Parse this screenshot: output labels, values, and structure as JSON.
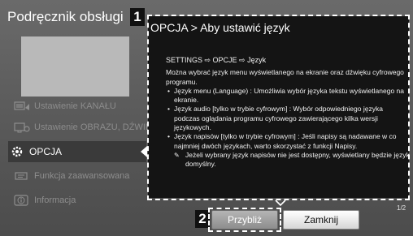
{
  "app_title": "Podręcznik obsługi",
  "callouts": {
    "first": "1",
    "second": "2"
  },
  "sidebar": {
    "items": [
      {
        "label": "Ustawienie KANAŁU",
        "icon": "channel-settings-icon"
      },
      {
        "label": "Ustawienie OBRAZU, DŹWIĘKU",
        "icon": "picture-sound-icon"
      },
      {
        "label": "OPCJA",
        "icon": "gear-icon",
        "selected": true
      },
      {
        "label": "Funkcja zaawansowana",
        "icon": "advanced-function-icon"
      },
      {
        "label": "Informacja",
        "icon": "info-icon"
      }
    ]
  },
  "panel": {
    "title": "OPCJA > Aby ustawić język",
    "settings_path": "SETTINGS ⇨ OPCJE ⇨ Język",
    "intro": "Można wybrać język menu wyświetlanego na ekranie oraz dźwięku cyfrowego programu.",
    "bullets": [
      "Język menu (Language) : Umożliwia wybór języka tekstu wyświetlanego na ekranie.",
      "Język audio [tylko w trybie cyfrowym] : Wybór odpowiedniego języka podczas oglądania programu cyfrowego zawierającego kilka wersji językowych.",
      "Język napisów [tylko w trybie cyfrowym] : Jeśli napisy są nadawane w co najmniej dwóch językach, warto skorzystać z funkcji Napisy."
    ],
    "note": "Jeżeli wybrany język napisów nie jest dostępny, wyświetlany będzie język domyślny.",
    "page_indicator": "1/2"
  },
  "buttons": {
    "prev": "Przybliż",
    "close": "Zamknij"
  },
  "colors": {
    "background": "#575757",
    "panel": "#141414",
    "preview": "#b9b9b9",
    "selected_item": "#3a3a3a",
    "inactive_text": "#8e8e8e"
  }
}
